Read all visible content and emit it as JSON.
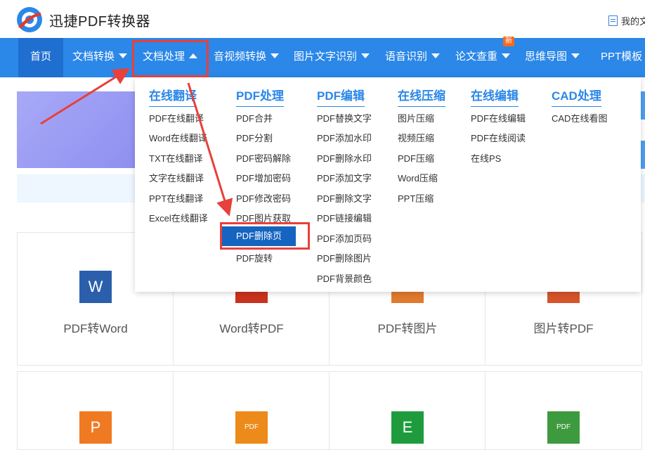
{
  "header": {
    "app_name": "迅捷PDF转换器",
    "my_docs": "我的文"
  },
  "nav": {
    "items": [
      {
        "label": "首页"
      },
      {
        "label": "文档转换"
      },
      {
        "label": "文档处理"
      },
      {
        "label": "音视频转换"
      },
      {
        "label": "图片文字识别"
      },
      {
        "label": "语音识别"
      },
      {
        "label": "论文查重"
      },
      {
        "label": "思维导图"
      },
      {
        "label": "PPT模板"
      }
    ],
    "new_badge": "新"
  },
  "dropdown": {
    "columns": [
      {
        "title": "在线翻译",
        "items": [
          "PDF在线翻译",
          "Word在线翻译",
          "TXT在线翻译",
          "文字在线翻译",
          "PPT在线翻译",
          "Excel在线翻译"
        ]
      },
      {
        "title": "PDF处理",
        "items": [
          "PDF合并",
          "PDF分割",
          "PDF密码解除",
          "PDF增加密码",
          "PDF修改密码",
          "PDF图片获取",
          "PDF删除页",
          "PDF旋转"
        ]
      },
      {
        "title": "PDF编辑",
        "items": [
          "PDF替换文字",
          "PDF添加水印",
          "PDF删除水印",
          "PDF添加文字",
          "PDF删除文字",
          "PDF链接编辑",
          "PDF添加页码",
          "PDF删除图片",
          "PDF背景颜色"
        ]
      },
      {
        "title": "在线压缩",
        "items": [
          "图片压缩",
          "视频压缩",
          "PDF压缩",
          "Word压缩",
          "PPT压缩"
        ]
      },
      {
        "title": "在线编辑",
        "items": [
          "PDF在线编辑",
          "PDF在线阅读",
          "在线PS"
        ]
      },
      {
        "title": "CAD处理",
        "items": [
          "CAD在线看图"
        ]
      }
    ],
    "selected_item": "PDF删除页"
  },
  "tiles": [
    {
      "label": "PDF转Word",
      "icon": "word-icon",
      "glyph": "W",
      "color": "#2b5fab"
    },
    {
      "label": "Word转PDF",
      "icon": "pdf-icon",
      "glyph": "",
      "color": "#c9331d"
    },
    {
      "label": "PDF转图片",
      "icon": "image-icon",
      "glyph": "",
      "color": "#e07a2e"
    },
    {
      "label": "图片转PDF",
      "icon": "pdf-icon",
      "glyph": "",
      "color": "#d5542b"
    },
    {
      "label": "",
      "icon": "ppt-icon",
      "glyph": "P",
      "color": "#f07a22"
    },
    {
      "label": "",
      "icon": "pdf-doc-icon",
      "glyph": "PDF",
      "color": "#ec8a1a"
    },
    {
      "label": "",
      "icon": "excel-icon",
      "glyph": "E",
      "color": "#1e9c3d"
    },
    {
      "label": "",
      "icon": "pdf-doc-icon",
      "glyph": "PDF",
      "color": "#3e9a3e"
    }
  ],
  "colors": {
    "nav_bg": "#2b87e8",
    "nav_active": "#1e6fd0",
    "accent": "#2b87e8",
    "selected_bg": "#1565c0",
    "annotation": "#e8403a"
  }
}
